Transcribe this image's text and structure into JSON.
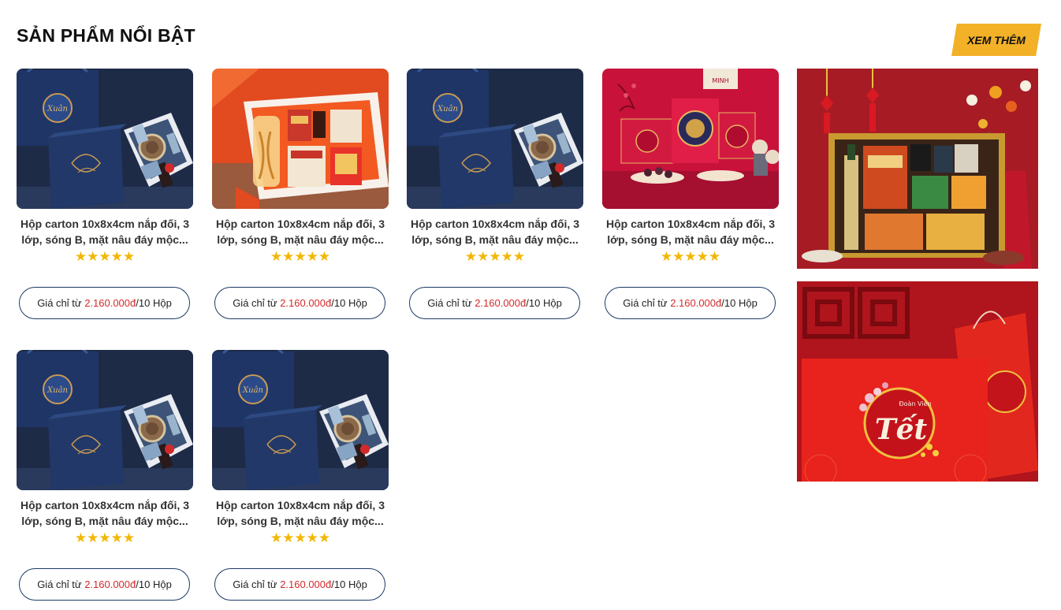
{
  "section": {
    "title": "SẢN PHẨM NỔI BẬT",
    "more_label": "XEM THÊM"
  },
  "products": [
    {
      "title": "Hộp carton 10x8x4cm nắp đối, 3 lớp, sóng B, mặt nâu đáy mộc...",
      "rating": 5,
      "price_prefix": "Giá chỉ từ ",
      "price": "2.160.000đ",
      "price_suffix": "/10 Hộp",
      "image": "navy-gift-box"
    },
    {
      "title": "Hộp carton 10x8x4cm nắp đối, 3 lớp, sóng B, mặt nâu đáy mộc...",
      "rating": 5,
      "price_prefix": "Giá chỉ từ ",
      "price": "2.160.000đ",
      "price_suffix": "/10 Hộp",
      "image": "orange-ginseng-box"
    },
    {
      "title": "Hộp carton 10x8x4cm nắp đối, 3 lớp, sóng B, mặt nâu đáy mộc...",
      "rating": 5,
      "price_prefix": "Giá chỉ từ ",
      "price": "2.160.000đ",
      "price_suffix": "/10 Hộp",
      "image": "navy-gift-box"
    },
    {
      "title": "Hộp carton 10x8x4cm nắp đối, 3 lớp, sóng B, mặt nâu đáy mộc...",
      "rating": 5,
      "price_prefix": "Giá chỉ từ ",
      "price": "2.160.000đ",
      "price_suffix": "/10 Hộp",
      "image": "red-tet-set"
    },
    {
      "title": "Hộp carton 10x8x4cm nắp đối, 3 lớp, sóng B, mặt nâu đáy mộc...",
      "rating": 5,
      "price_prefix": "Giá chỉ từ ",
      "price": "2.160.000đ",
      "price_suffix": "/10 Hộp",
      "image": "navy-gift-box"
    },
    {
      "title": "Hộp carton 10x8x4cm nắp đối, 3 lớp, sóng B, mặt nâu đáy mộc...",
      "rating": 5,
      "price_prefix": "Giá chỉ từ ",
      "price": "2.160.000đ",
      "price_suffix": "/10 Hộp",
      "image": "navy-gift-box"
    }
  ],
  "banners": [
    {
      "image": "tet-hamper-gold-box"
    },
    {
      "image": "tet-red-bag",
      "logo_text": "Tết",
      "logo_small_text": "Đoàn Viên"
    }
  ],
  "colors": {
    "accent": "#f2b127",
    "price": "#d42b2b",
    "button_border": "#1c3a66",
    "star": "#f2b705"
  }
}
